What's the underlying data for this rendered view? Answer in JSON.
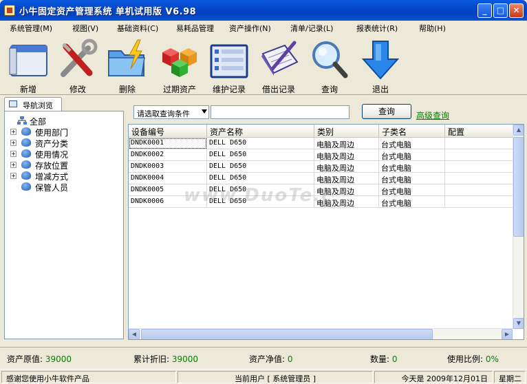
{
  "window": {
    "title": "小牛固定资产管理系统  单机试用版  V6.98",
    "min": "_",
    "max": "□",
    "close": "✕"
  },
  "menu": [
    {
      "label": "系统管理(M)"
    },
    {
      "label": "视图(V)"
    },
    {
      "label": "基础资料(C)"
    },
    {
      "label": "易耗品管理"
    },
    {
      "label": "资产操作(N)"
    },
    {
      "label": "清单/记录(L)"
    },
    {
      "label": "报表统计(R)"
    },
    {
      "label": "帮助(H)"
    }
  ],
  "toolbar": [
    {
      "label": "新增",
      "icon": "window-new-icon"
    },
    {
      "label": "修改",
      "icon": "tools-icon"
    },
    {
      "label": "删除",
      "icon": "folder-lightning-icon"
    },
    {
      "label": "过期资产",
      "icon": "cubes-icon"
    },
    {
      "label": "维护记录",
      "icon": "list-window-icon"
    },
    {
      "label": "借出记录",
      "icon": "notebook-pen-icon"
    },
    {
      "label": "查询",
      "icon": "magnifier-icon"
    },
    {
      "label": "退出",
      "icon": "down-arrow-icon"
    }
  ],
  "nav": {
    "tab_label": "导航浏览",
    "root": "全部",
    "items": [
      {
        "label": "使用部门",
        "expand": "+"
      },
      {
        "label": "资产分类",
        "expand": "+"
      },
      {
        "label": "使用情况",
        "expand": "+"
      },
      {
        "label": "存放位置",
        "expand": "+"
      },
      {
        "label": "增减方式",
        "expand": "+"
      },
      {
        "label": "保管人员",
        "expand": ""
      }
    ]
  },
  "search": {
    "condition_value": "请选取查询条件",
    "query_value": "",
    "query_button": "查询",
    "advanced_link": "高级查询"
  },
  "grid": {
    "columns": [
      "设备编号",
      "资产名称",
      "类别",
      "子类名",
      "配置"
    ],
    "rows": [
      [
        "DNDK0001",
        "DELL D650",
        "电脑及周边",
        "台式电脑",
        ""
      ],
      [
        "DNDK0002",
        "DELL D650",
        "电脑及周边",
        "台式电脑",
        ""
      ],
      [
        "DNDK0003",
        "DELL D650",
        "电脑及周边",
        "台式电脑",
        ""
      ],
      [
        "DNDK0004",
        "DELL D650",
        "电脑及周边",
        "台式电脑",
        ""
      ],
      [
        "DNDK0005",
        "DELL D650",
        "电脑及周边",
        "台式电脑",
        ""
      ],
      [
        "DNDK0006",
        "DELL D650",
        "电脑及周边",
        "台式电脑",
        ""
      ]
    ],
    "watermark": "www.DuoTe.c"
  },
  "summary": {
    "original_label": "资产原值:",
    "original_value": "39000",
    "depr_label": "累计折旧:",
    "depr_value": "39000",
    "net_label": "资产净值:",
    "net_value": "0",
    "count_label": "数量:",
    "count_value": "0",
    "ratio_label": "使用比例:",
    "ratio_value": "0%"
  },
  "status": {
    "thanks": "感谢您使用小牛软件产品",
    "user": "当前用户 [ 系统管理员 ]",
    "date": "今天是 2009年12月01日",
    "weekday": "星期二"
  }
}
